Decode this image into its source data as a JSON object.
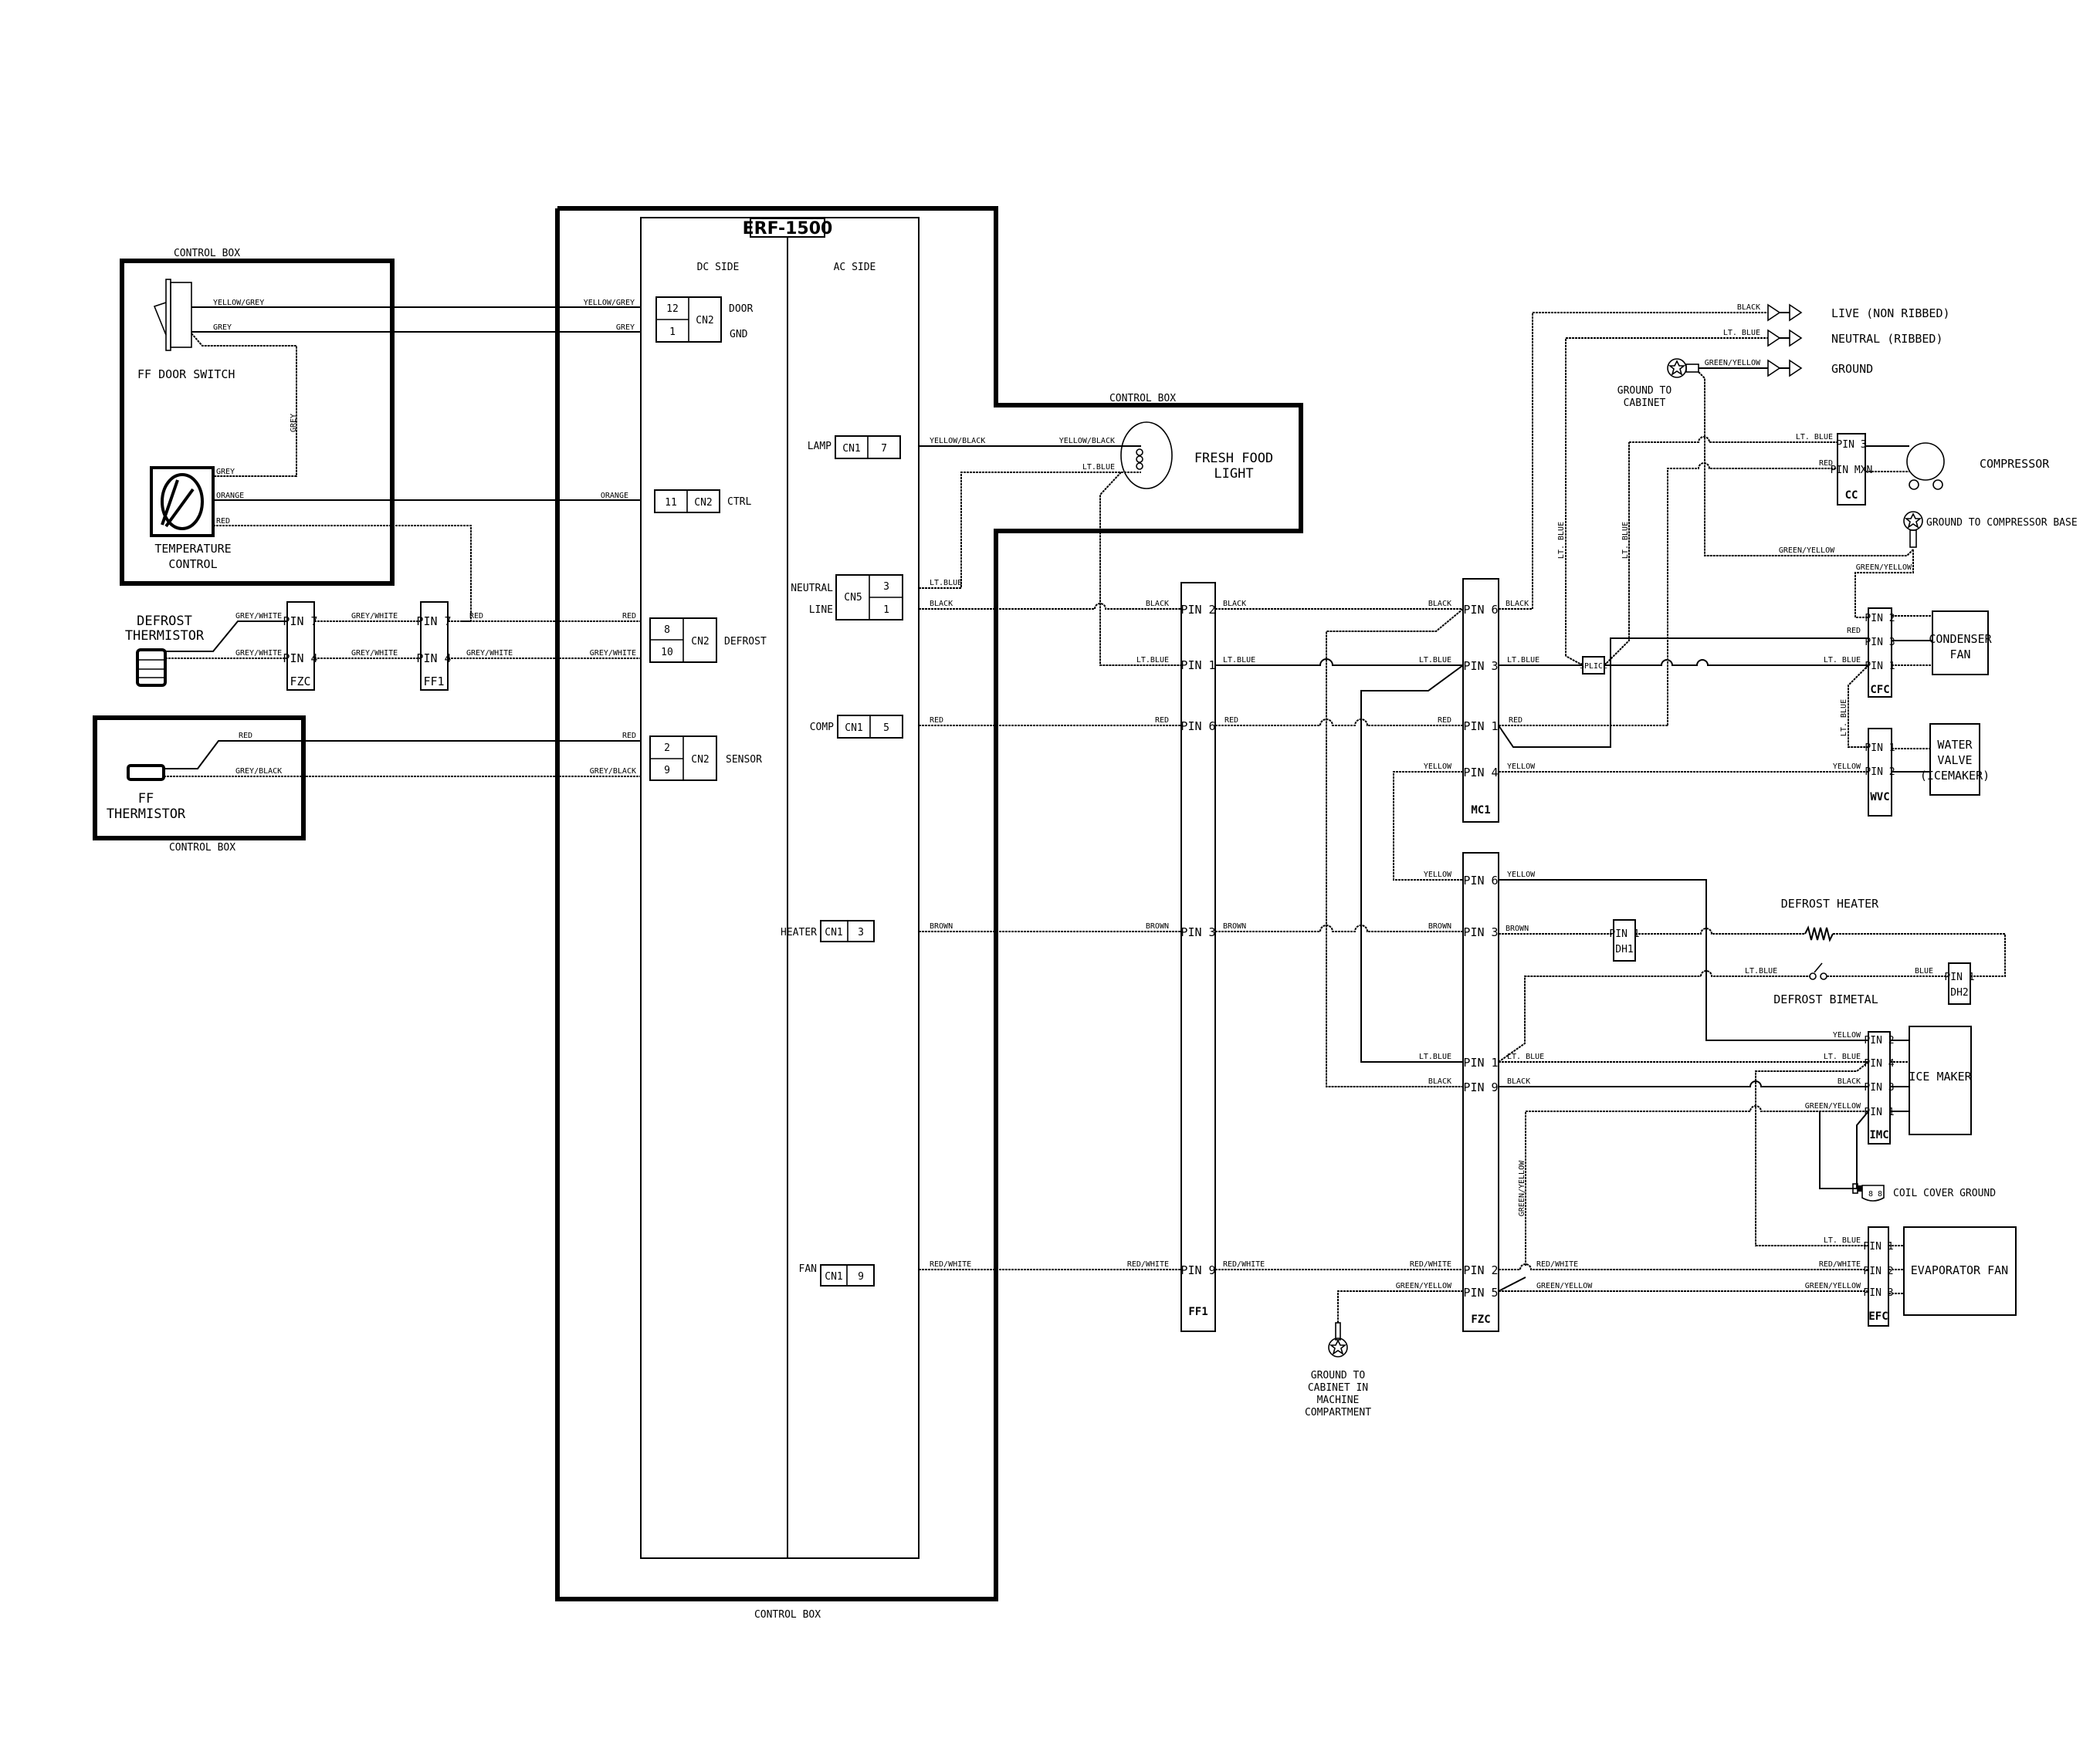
{
  "title": "ERF-1500",
  "control_box_label": "CONTROL BOX",
  "board": {
    "dc_side": "DC SIDE",
    "ac_side": "AC SIDE",
    "dc_connectors": [
      {
        "name": "CN2",
        "pins": [
          "12",
          "1"
        ],
        "functions": [
          "DOOR",
          "GND"
        ],
        "wires": [
          "YELLOW/GREY",
          "GREY"
        ]
      },
      {
        "name": "CN2",
        "pins": [
          "11"
        ],
        "functions": [
          "CTRL"
        ],
        "wires": [
          "ORANGE"
        ]
      },
      {
        "name": "CN2",
        "pins": [
          "8",
          "10"
        ],
        "functions": [
          "DEFROST"
        ],
        "wires": [
          "RED",
          "GREY/WHITE"
        ]
      },
      {
        "name": "CN2",
        "pins": [
          "2",
          "9"
        ],
        "functions": [
          "SENSOR"
        ],
        "wires": [
          "RED",
          "GREY/BLACK"
        ]
      }
    ],
    "ac_connectors": [
      {
        "function": "LAMP",
        "name": "CN1",
        "pin": "7",
        "wire": "YELLOW/BLACK"
      },
      {
        "function": "NEUTRAL",
        "name": "CN5",
        "pin": "3",
        "wire": "LT.BLUE"
      },
      {
        "function": "LINE",
        "name": "CN5",
        "pin": "1",
        "wire": "BLACK"
      },
      {
        "function": "COMP",
        "name": "CN1",
        "pin": "5",
        "wire": "RED"
      },
      {
        "function": "HEATER",
        "name": "CN1",
        "pin": "3",
        "wire": "BROWN"
      },
      {
        "function": "FAN",
        "name": "CN1",
        "pin": "9",
        "wire": "RED/WHITE"
      }
    ]
  },
  "components": {
    "ff_door_switch": "FF DOOR SWITCH",
    "temperature_control": [
      "TEMPERATURE",
      "CONTROL"
    ],
    "defrost_thermistor": [
      "DEFROST",
      "THERMISTOR"
    ],
    "ff_thermistor": [
      "FF",
      "THERMISTOR"
    ],
    "fresh_food_light": [
      "FRESH FOOD",
      "LIGHT"
    ],
    "compressor": "COMPRESSOR",
    "condenser_fan": [
      "CONDENSER",
      "FAN"
    ],
    "water_valve": [
      "WATER",
      "VALVE",
      "(ICEMAKER)"
    ],
    "defrost_heater": "DEFROST HEATER",
    "defrost_bimetal": "DEFROST BIMETAL",
    "ice_maker": "ICE MAKER",
    "evaporator_fan": "EVAPORATOR FAN",
    "splice": "SPLICE"
  },
  "power": [
    {
      "label": "LIVE (NON RIBBED)",
      "wire": "BLACK"
    },
    {
      "label": "NEUTRAL (RIBBED)",
      "wire": "LT. BLUE"
    },
    {
      "label": "GROUND",
      "wire": "GREEN/YELLOW"
    }
  ],
  "grounds": {
    "cabinet": [
      "GROUND TO",
      "CABINET"
    ],
    "compressor_base": "GROUND TO COMPRESSOR BASE",
    "coil_cover": "COIL COVER GROUND",
    "machine_compartment": [
      "GROUND TO",
      "CABINET IN",
      "MACHINE",
      "COMPARTMENT"
    ]
  },
  "harness_connectors": {
    "fzc_small": {
      "name": "FZC",
      "pins": [
        "PIN 7",
        "PIN 4"
      ]
    },
    "ff1_small": {
      "name": "FF1",
      "pins": [
        "PIN 7",
        "PIN 4"
      ]
    },
    "ff1": {
      "name": "FF1",
      "pins": [
        "PIN 2",
        "PIN 1",
        "PIN 6",
        "PIN 3",
        "PIN 9"
      ]
    },
    "mc1": {
      "name": "MC1",
      "pins": [
        "PIN 6",
        "PIN 3",
        "PIN 1",
        "PIN 4"
      ]
    },
    "fzc": {
      "name": "FZC",
      "pins": [
        "PIN 6",
        "PIN 3",
        "PIN 1",
        "PIN 9",
        "PIN 2",
        "PIN 5"
      ]
    },
    "cc": {
      "name": "CC",
      "pins": [
        "PIN 3",
        "PIN MXN"
      ]
    },
    "cfc": {
      "name": "CFC",
      "pins": [
        "PIN 2",
        "PIN 3",
        "PIN 1"
      ]
    },
    "wvc": {
      "name": "WVC",
      "pins": [
        "PIN 1",
        "PIN 2"
      ]
    },
    "dh1": {
      "name": "DH1",
      "pins": [
        "PIN 1"
      ]
    },
    "dh2": {
      "name": "DH2",
      "pins": [
        "PIN 1"
      ]
    },
    "imc": {
      "name": "IMC",
      "pins": [
        "PIN 2",
        "PIN 4",
        "PIN 3",
        "PIN 1"
      ]
    },
    "efc": {
      "name": "EFC",
      "pins": [
        "PIN 1",
        "PIN 2",
        "PIN 3"
      ]
    }
  },
  "wire_colors": {
    "yellow_grey": "YELLOW/GREY",
    "grey": "GREY",
    "orange": "ORANGE",
    "red": "RED",
    "grey_white": "GREY/WHITE",
    "grey_black": "GREY/BLACK",
    "yellow_black": "YELLOW/BLACK",
    "lt_blue": "LT.BLUE",
    "lt_blue_sp": "LT. BLUE",
    "black": "BLACK",
    "brown": "BROWN",
    "red_white": "RED/WHITE",
    "yellow": "YELLOW",
    "green_yellow": "GREEN/YELLOW",
    "blue": "BLUE"
  }
}
